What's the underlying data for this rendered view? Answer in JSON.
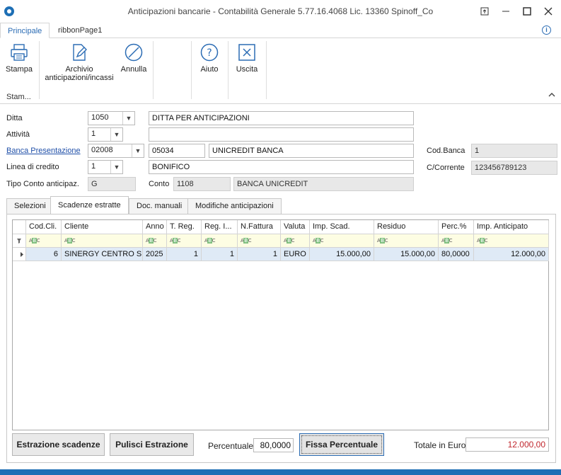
{
  "window": {
    "title": "Anticipazioni bancarie - Contabilità Generale 5.77.16.4068 Lic. 13360 Spinoff_Co",
    "icon": "app-logo-icon",
    "controls": [
      "restore-icon",
      "minimize-icon",
      "maximize-icon",
      "close-icon"
    ]
  },
  "ribbon": {
    "tabs": [
      "Principale",
      "ribbonPage1"
    ],
    "buttons": {
      "stampa": "Stampa",
      "archivio_line1": "Archivio",
      "archivio_line2": "anticipazioni/incassi",
      "annulla": "Annulla",
      "aiuto": "Aiuto",
      "uscita": "Uscita"
    },
    "group_label": "Stam..."
  },
  "form": {
    "ditta": {
      "label": "Ditta",
      "code": "1050",
      "description": "DITTA PER ANTICIPAZIONI"
    },
    "attivita": {
      "label": "Attività",
      "code": "1",
      "description": ""
    },
    "banca": {
      "label": "Banca Presentazione",
      "code": "02008",
      "abi_cab": "05034",
      "name": "UNICREDIT BANCA"
    },
    "linea": {
      "label": "Linea di credito",
      "code": "1",
      "description": "BONIFICO"
    },
    "tipo_conto": {
      "label": "Tipo Conto anticipaz.",
      "value": "G"
    },
    "conto": {
      "label": "Conto",
      "code": "1108",
      "description": "BANCA UNICREDIT"
    },
    "cod_banca": {
      "label": "Cod.Banca",
      "value": "1"
    },
    "c_corrente": {
      "label": "C/Corrente",
      "value": "123456789123"
    }
  },
  "tabs": [
    "Selezioni",
    "Scadenze estratte",
    "Doc. manuali",
    "Modifiche anticipazioni"
  ],
  "active_tab": "Scadenze estratte",
  "grid": {
    "columns": [
      "Cod.Cli.",
      "Cliente",
      "Anno",
      "T. Reg.",
      "Reg. I...",
      "N.Fattura",
      "Valuta",
      "Imp. Scad.",
      "Residuo",
      "Perc.%",
      "Imp. Anticipato"
    ],
    "rows": [
      [
        "6",
        "SINERGY CENTRO S...",
        "2025",
        "1",
        "1",
        "1",
        "EURO",
        "15.000,00",
        "15.000,00",
        "80,0000",
        "12.000,00"
      ]
    ]
  },
  "bottom": {
    "estrazione": "Estrazione scadenze",
    "pulisci": "Pulisci Estrazione",
    "percentuale_label": "Percentuale",
    "percentuale_value": "80,0000",
    "fissa": "Fissa Percentuale",
    "totale_label": "Totale in Euro",
    "totale_value": "12.000,00"
  },
  "colors": {
    "accent": "#2b6cb4",
    "link": "#1f4fa8",
    "total": "#c0262d",
    "status_bar": "#1e6fb5"
  }
}
